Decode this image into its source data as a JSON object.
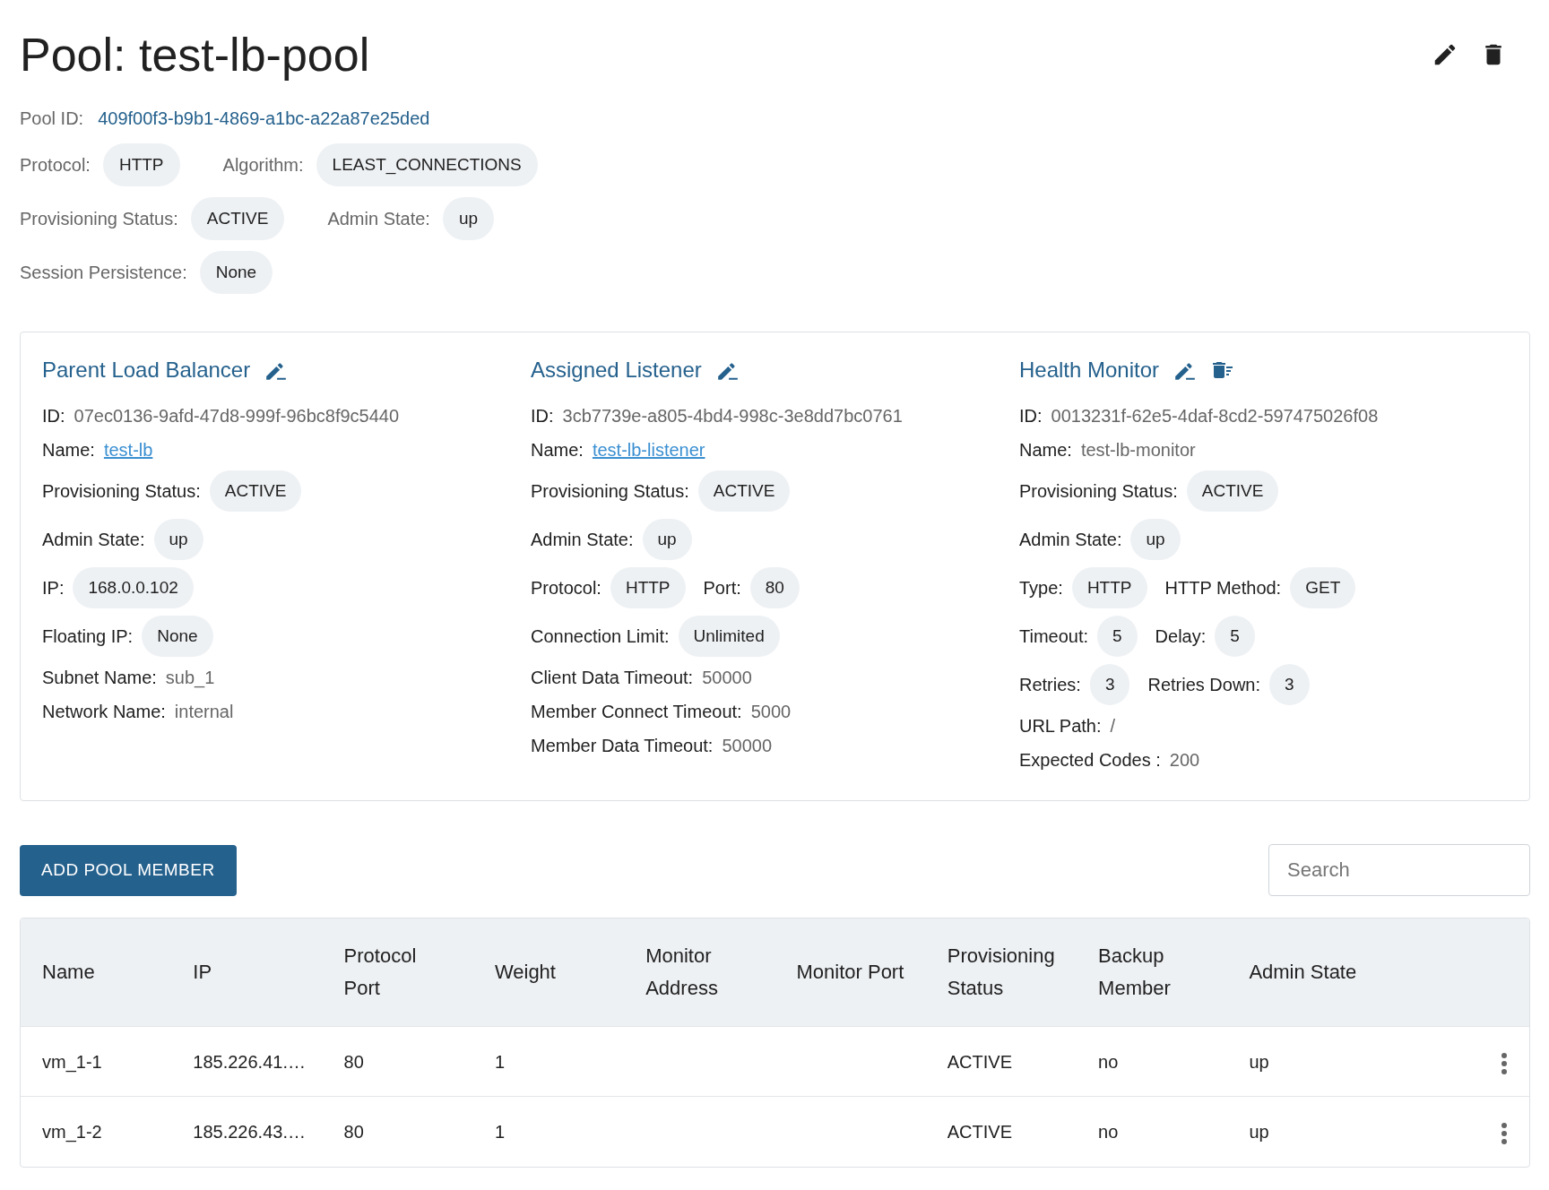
{
  "title": "Pool: test-lb-pool",
  "header_actions": [
    {
      "kind": "edit"
    },
    {
      "kind": "delete"
    }
  ],
  "pool_id": {
    "label": "Pool ID:",
    "value": "409f00f3-b9b1-4869-a1bc-a22a87e25ded"
  },
  "summary": [
    [
      {
        "label": "Protocol:",
        "value": "HTTP",
        "kind": "chip"
      },
      {
        "label": "Algorithm:",
        "value": "LEAST_CONNECTIONS",
        "kind": "chip"
      }
    ],
    [
      {
        "label": "Provisioning Status:",
        "value": "ACTIVE",
        "kind": "chip"
      },
      {
        "label": "Admin State:",
        "value": "up",
        "kind": "chip"
      }
    ],
    [
      {
        "label": "Session Persistence:",
        "value": "None",
        "kind": "chip"
      }
    ]
  ],
  "sections": [
    {
      "title": "Parent Load Balancer",
      "actions": [
        {
          "kind": "edit"
        }
      ],
      "rows": [
        [
          {
            "label": "ID:",
            "value": "07ec0136-9afd-47d8-999f-96bc8f9c5440",
            "kind": "text"
          }
        ],
        [
          {
            "label": "Name:",
            "value": "test-lb",
            "kind": "link"
          }
        ],
        [
          {
            "label": "Provisioning Status:",
            "value": "ACTIVE",
            "kind": "chip"
          }
        ],
        [
          {
            "label": "Admin State:",
            "value": "up",
            "kind": "chip"
          }
        ],
        [
          {
            "label": "IP:",
            "value": "168.0.0.102",
            "kind": "chip"
          }
        ],
        [
          {
            "label": "Floating IP:",
            "value": "None",
            "kind": "chip"
          }
        ],
        [
          {
            "label": "Subnet Name:",
            "value": "sub_1",
            "kind": "text"
          }
        ],
        [
          {
            "label": "Network Name:",
            "value": "internal",
            "kind": "text"
          }
        ]
      ]
    },
    {
      "title": "Assigned Listener",
      "actions": [
        {
          "kind": "edit"
        }
      ],
      "rows": [
        [
          {
            "label": "ID:",
            "value": "3cb7739e-a805-4bd4-998c-3e8dd7bc0761",
            "kind": "text"
          }
        ],
        [
          {
            "label": "Name:",
            "value": "test-lb-listener",
            "kind": "link"
          }
        ],
        [
          {
            "label": "Provisioning Status:",
            "value": "ACTIVE",
            "kind": "chip"
          }
        ],
        [
          {
            "label": "Admin State:",
            "value": "up",
            "kind": "chip"
          }
        ],
        [
          {
            "label": "Protocol:",
            "value": "HTTP",
            "kind": "chip"
          },
          {
            "label": "Port:",
            "value": "80",
            "kind": "chip"
          }
        ],
        [
          {
            "label": "Connection Limit:",
            "value": "Unlimited",
            "kind": "chip"
          }
        ],
        [
          {
            "label": "Client Data Timeout:",
            "value": "50000",
            "kind": "text"
          }
        ],
        [
          {
            "label": "Member Connect Timeout:",
            "value": "5000",
            "kind": "text"
          }
        ],
        [
          {
            "label": "Member Data Timeout:",
            "value": "50000",
            "kind": "text"
          }
        ]
      ]
    },
    {
      "title": "Health Monitor",
      "actions": [
        {
          "kind": "edit"
        },
        {
          "kind": "delete-list"
        }
      ],
      "rows": [
        [
          {
            "label": "ID:",
            "value": "0013231f-62e5-4daf-8cd2-597475026f08",
            "kind": "text"
          }
        ],
        [
          {
            "label": "Name:",
            "value": "test-lb-monitor",
            "kind": "text"
          }
        ],
        [
          {
            "label": "Provisioning Status:",
            "value": "ACTIVE",
            "kind": "chip"
          }
        ],
        [
          {
            "label": "Admin State:",
            "value": "up",
            "kind": "chip"
          }
        ],
        [
          {
            "label": "Type:",
            "value": "HTTP",
            "kind": "chip"
          },
          {
            "label": "HTTP Method:",
            "value": "GET",
            "kind": "chip"
          }
        ],
        [
          {
            "label": "Timeout:",
            "value": "5",
            "kind": "chip"
          },
          {
            "label": "Delay:",
            "value": "5",
            "kind": "chip"
          }
        ],
        [
          {
            "label": "Retries:",
            "value": "3",
            "kind": "chip"
          },
          {
            "label": "Retries Down:",
            "value": "3",
            "kind": "chip"
          }
        ],
        [
          {
            "label": "URL Path:",
            "value": "/",
            "kind": "text"
          }
        ],
        [
          {
            "label": "Expected Codes :",
            "value": "200",
            "kind": "text"
          }
        ]
      ]
    }
  ],
  "add_button": "ADD POOL MEMBER",
  "search": {
    "placeholder": "Search"
  },
  "table": {
    "columns": [
      "Name",
      "IP",
      "Protocol Port",
      "Weight",
      "Monitor Address",
      "Monitor Port",
      "Provisioning Status",
      "Backup Member",
      "Admin State"
    ],
    "rows": [
      [
        "vm_1-1",
        "185.226.41.…",
        "80",
        "1",
        "",
        "",
        "ACTIVE",
        "no",
        "up"
      ],
      [
        "vm_1-2",
        "185.226.43.…",
        "80",
        "1",
        "",
        "",
        "ACTIVE",
        "no",
        "up"
      ]
    ]
  }
}
